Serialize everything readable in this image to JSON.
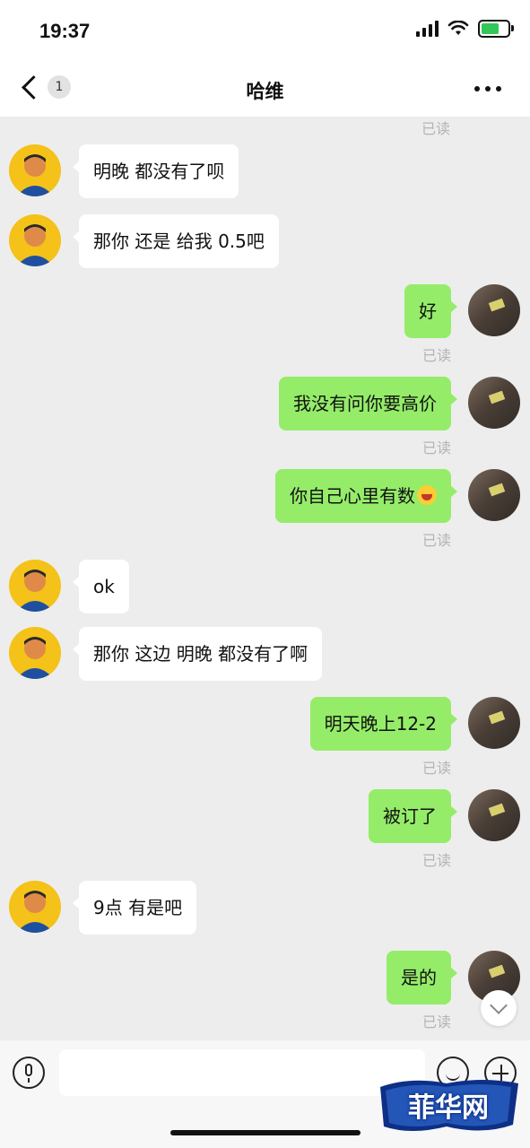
{
  "status_bar": {
    "time": "19:37",
    "battery_color": "#32c759"
  },
  "nav": {
    "back_badge": "1",
    "title": "哈维",
    "more_icon": "more-icon"
  },
  "chat": {
    "top_read_label": "已读",
    "messages": [
      {
        "side": "left",
        "text": "明晚 都没有了呗"
      },
      {
        "side": "left",
        "text": "那你 还是 给我 0.5吧"
      },
      {
        "side": "right",
        "text": "好",
        "read": "已读"
      },
      {
        "side": "right",
        "text": "我没有问你要高价",
        "read": "已读"
      },
      {
        "side": "right",
        "text": "你自己心里有数",
        "emoji": "laughing-face-icon",
        "read": "已读"
      },
      {
        "side": "left",
        "text": "ok"
      },
      {
        "side": "left",
        "text": "那你 这边 明晚 都没有了啊"
      },
      {
        "side": "right",
        "text": "明天晚上12-2",
        "read": "已读"
      },
      {
        "side": "right",
        "text": "被订了",
        "read": "已读"
      },
      {
        "side": "left",
        "text": "9点 有是吧"
      },
      {
        "side": "right",
        "text": "是的",
        "read": "已读"
      }
    ]
  },
  "input_bar": {
    "message_value": "",
    "placeholder": ""
  },
  "colors": {
    "sent_bubble": "#95ec69",
    "received_bubble": "#ffffff",
    "background": "#ededed",
    "watermark": "#0d2f86"
  },
  "watermark": {
    "text": "菲华网"
  }
}
